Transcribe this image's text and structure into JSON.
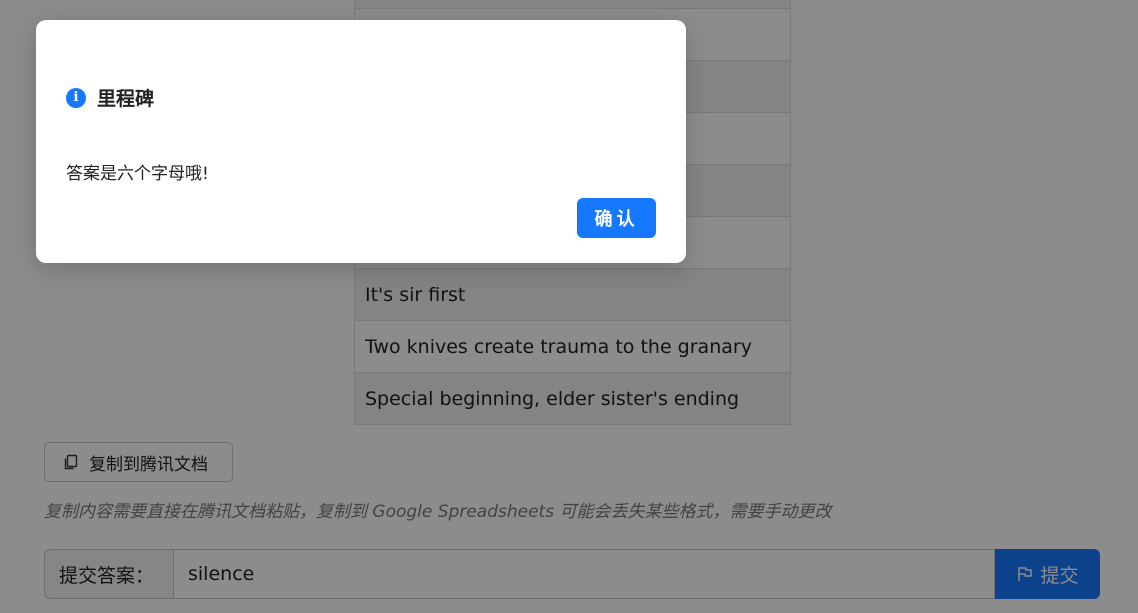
{
  "table": {
    "rows": [
      "",
      "",
      "",
      "",
      "",
      "",
      "It's sir first",
      "Two knives create trauma to the granary",
      "Special beginning, elder sister's ending"
    ]
  },
  "toolbar": {
    "copy_label": "复制到腾讯文档",
    "hint": "复制内容需要直接在腾讯文档粘贴，复制到 Google Spreadsheets 可能会丢失某些格式，需要手动更改"
  },
  "answer": {
    "label": "提交答案：",
    "value": "silence",
    "submit_label": "提交"
  },
  "modal": {
    "title": "里程碑",
    "content": "答案是六个字母哦!",
    "ok_label": "确认",
    "icon": "info-icon",
    "accent": "#1677ff"
  }
}
